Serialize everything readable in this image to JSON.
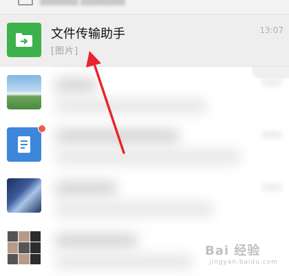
{
  "active_chat": {
    "name": "文件传输助手",
    "preview": "[图片]",
    "time": "13:07"
  },
  "watermark": {
    "main": "Bai 经验",
    "sub": "jingyan.baidu.com"
  },
  "colors": {
    "file_helper_green": "#3db24b",
    "annotation_red": "#e8242c",
    "badge_red": "#f15a4a"
  },
  "icons": [
    "folder-arrow-icon",
    "document-icon"
  ]
}
